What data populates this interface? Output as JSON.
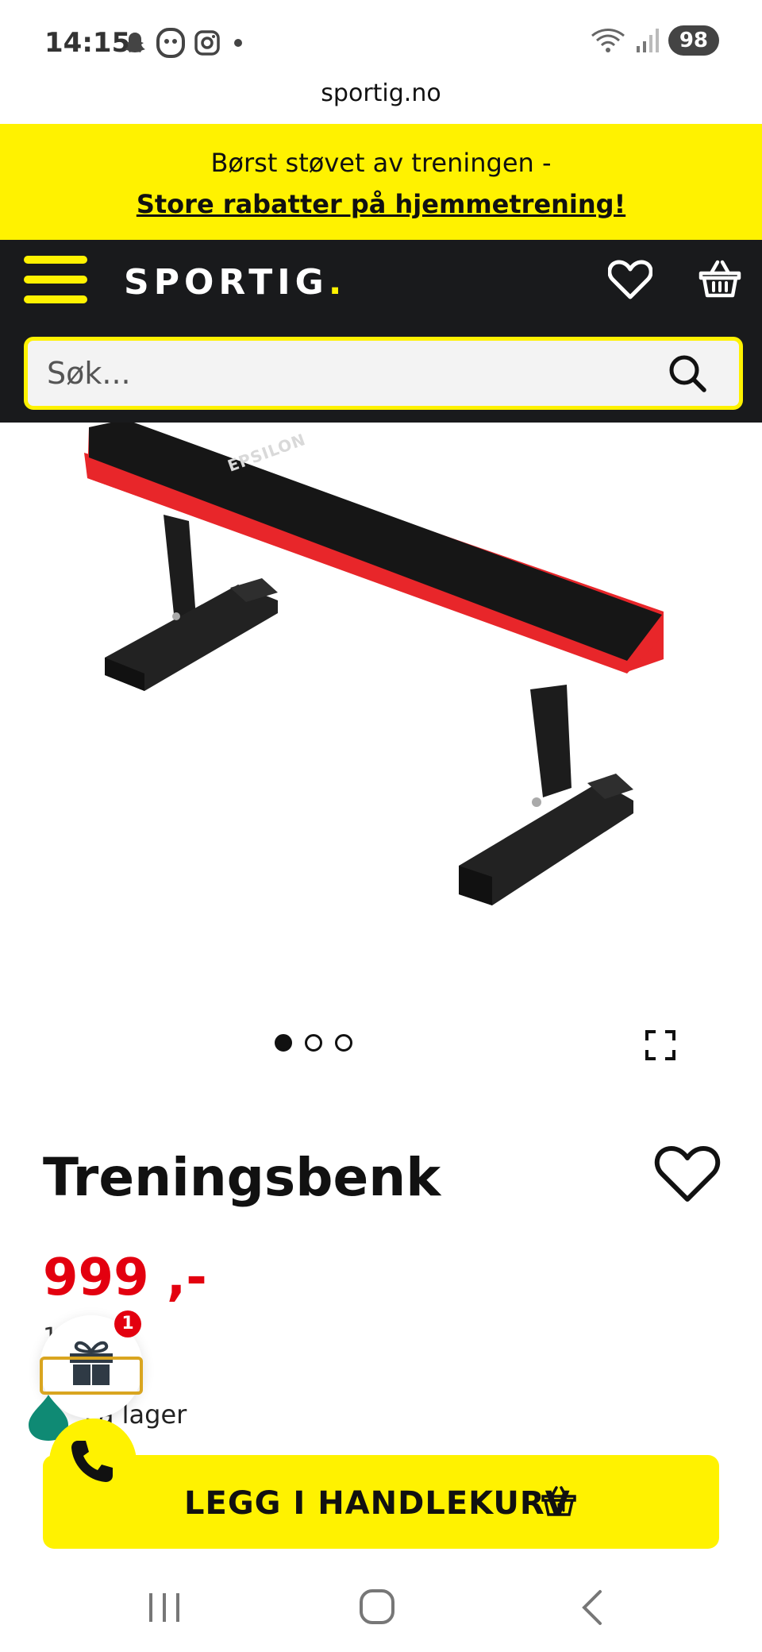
{
  "status_bar": {
    "time": "14:15",
    "battery": "98",
    "icons": [
      "snapchat-icon",
      "face-icon",
      "instagram-icon",
      "dot-icon",
      "wifi-icon",
      "signal-icon"
    ]
  },
  "browser": {
    "url": "sportig.no"
  },
  "promo": {
    "line1": "Børst støvet av treningen -",
    "line2": "Store rabatter på hjemmetrening!"
  },
  "header": {
    "logo_text": "SPORTIG",
    "logo_dot": ".",
    "search_placeholder": "Søk..."
  },
  "product": {
    "image_brand": "EPSILON",
    "carousel": {
      "count": 3,
      "active_index": 0
    },
    "title": "Treningsbenk",
    "price": "999 ,-",
    "old_price_partial": "1  ,-",
    "stock_status": "På lager",
    "add_to_cart_label": "LEGG I HANDLEKURV"
  },
  "widgets": {
    "gift_badge_count": "1"
  },
  "colors": {
    "brand_yellow": "#fff200",
    "header_dark": "#191a1c",
    "price_red": "#e3000f",
    "bench_red": "#e8262a",
    "chat_teal": "#0f8a74"
  }
}
